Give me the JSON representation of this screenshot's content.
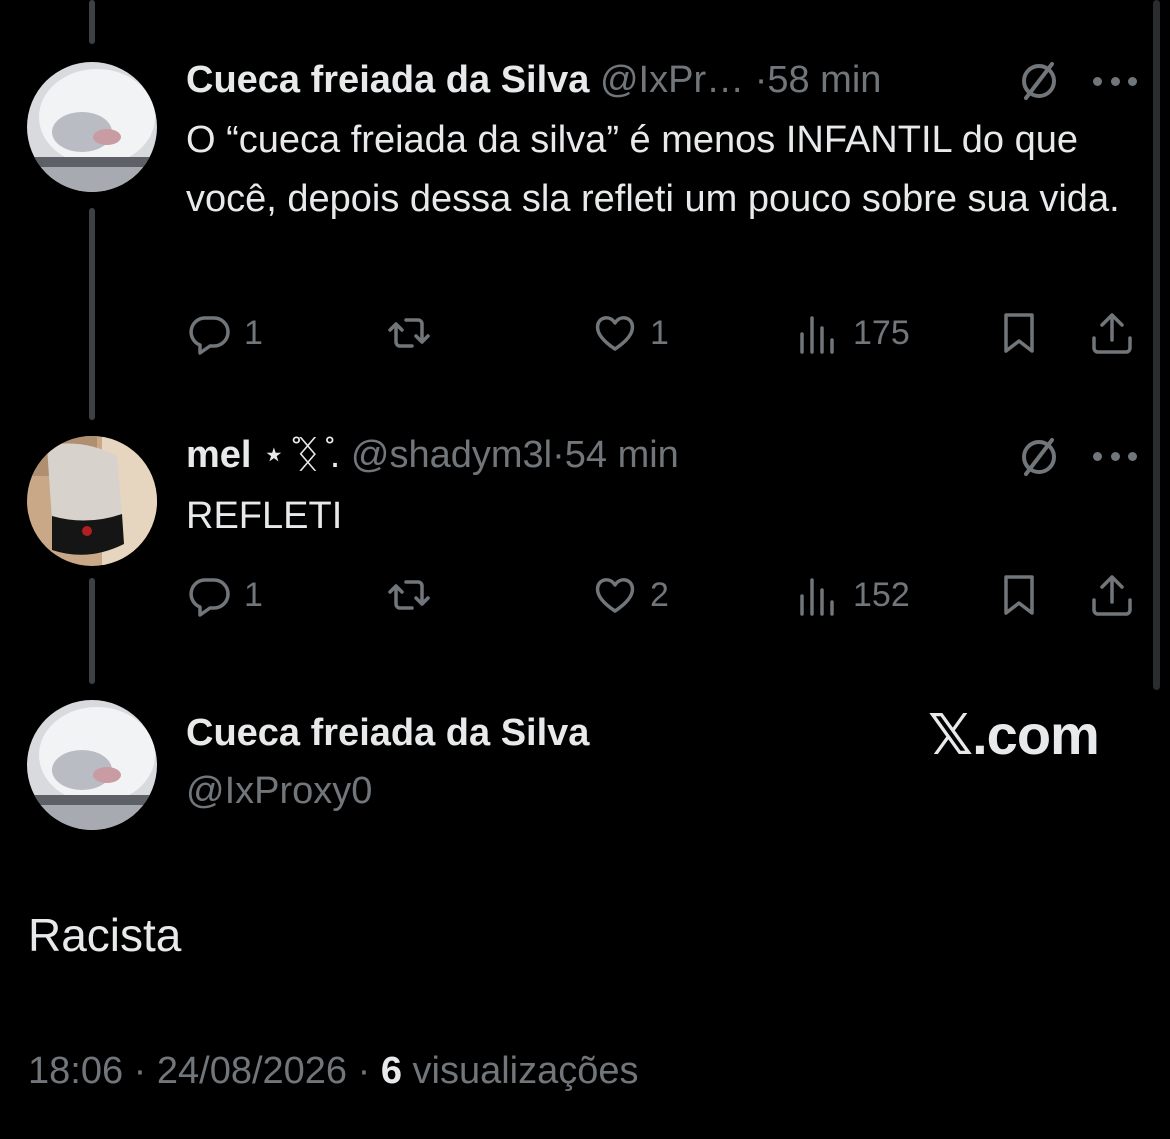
{
  "reply1": {
    "name": "Cueca freiada da Silva",
    "handle": "@IxPr…",
    "time": "58 min",
    "text": "O “cueca freiada da silva” é menos INFANTIL do que você, depois dessa sla refleti um pouco sobre sua vida.",
    "replies": "1",
    "reposts": "",
    "likes": "1",
    "views": "175"
  },
  "reply2": {
    "name": "mel",
    "name_decoration": "⋆ ̊ᛝ ̊.",
    "handle": "@shadym3l",
    "time": "54 min",
    "text": "REFLETI",
    "replies": "1",
    "reposts": "",
    "likes": "2",
    "views": "152"
  },
  "main": {
    "name": "Cueca freiada da Silva",
    "handle": "@IxProxy0",
    "watermark": "𝕏.com",
    "text": "Racista",
    "timestamp": "18:06 · 24/08/2026 · ",
    "views_count": "6",
    "views_label": " visualizações"
  },
  "separator": "·",
  "colors": {
    "background": "#000000",
    "text": "#e7e9ea",
    "muted": "#71767b",
    "thread_line": "#3e4144"
  },
  "icons": [
    "reply-icon",
    "repost-icon",
    "like-icon",
    "views-icon",
    "bookmark-icon",
    "share-icon",
    "grok-icon",
    "more-icon"
  ]
}
